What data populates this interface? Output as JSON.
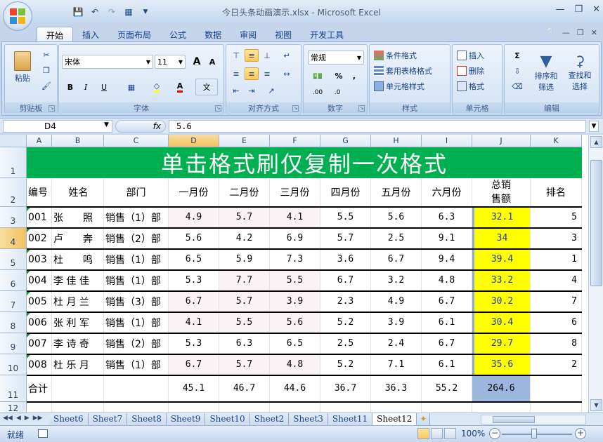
{
  "window": {
    "title": "今日头条动画演示.xlsx - Microsoft Excel",
    "minimize_icon": "minimize-icon",
    "restore_icon": "restore-icon",
    "close_icon": "close-icon"
  },
  "tabs": [
    {
      "label": "开始"
    },
    {
      "label": "插入"
    },
    {
      "label": "页面布局"
    },
    {
      "label": "公式"
    },
    {
      "label": "数据"
    },
    {
      "label": "审阅"
    },
    {
      "label": "视图"
    },
    {
      "label": "开发工具"
    }
  ],
  "ribbon": {
    "clipboard": {
      "label": "剪贴板",
      "paste": "粘贴"
    },
    "font": {
      "label": "字体",
      "name": "宋体",
      "size": "11",
      "bold": "B",
      "italic": "I",
      "underline": "U",
      "grow": "A",
      "shrink": "A",
      "font_color": "A",
      "phonetic": "文"
    },
    "alignment": {
      "label": "对齐方式"
    },
    "number": {
      "label": "数字",
      "format": "常规",
      "percent": "%",
      "comma": ",",
      "inc_decimal": ".00",
      "dec_decimal": ".0"
    },
    "styles": {
      "label": "样式",
      "conditional": "条件格式",
      "table": "套用表格格式",
      "cell_styles": "单元格样式"
    },
    "cells": {
      "label": "单元格",
      "insert": "插入",
      "delete": "删除",
      "format": "格式"
    },
    "editing": {
      "label": "编辑",
      "sum": "Σ",
      "sort": "排序和",
      "sort2": "筛选",
      "find": "查找和",
      "find2": "选择"
    }
  },
  "formula_bar": {
    "name_box": "D4",
    "fx": "fx",
    "value": "5.6"
  },
  "sheet": {
    "columns": [
      "A",
      "B",
      "C",
      "D",
      "E",
      "F",
      "G",
      "H",
      "I",
      "J",
      "K"
    ],
    "active_column": "D",
    "active_row": "4",
    "title": "单击格式刷仅复制一次格式",
    "headers": [
      "编号",
      "姓名",
      "部门",
      "一月份",
      "二月份",
      "三月份",
      "四月份",
      "五月份",
      "六月份",
      "总销售额",
      "排名"
    ],
    "header_j_line1": "总销",
    "header_j_line2": "售额",
    "rows": [
      {
        "id": "001",
        "name": "张　　照",
        "dept": "销售（1）部",
        "m": [
          "4.9",
          "5.7",
          "4.1",
          "5.5",
          "5.6",
          "6.3"
        ],
        "total": "32.1",
        "rank": "5"
      },
      {
        "id": "002",
        "name": "卢　　奔",
        "dept": "销售（2）部",
        "m": [
          "5.6",
          "4.2",
          "6.9",
          "5.7",
          "2.5",
          "9.1"
        ],
        "total": "34",
        "rank": "3"
      },
      {
        "id": "003",
        "name": "杜　　鸣",
        "dept": "销售（1）部",
        "m": [
          "6.5",
          "5.9",
          "7.3",
          "3.6",
          "6.7",
          "9.4"
        ],
        "total": "39.4",
        "rank": "1"
      },
      {
        "id": "004",
        "name": "李 佳 佳",
        "dept": "销售（1）部",
        "m": [
          "5.3",
          "7.7",
          "5.5",
          "6.7",
          "3.2",
          "4.8"
        ],
        "total": "33.2",
        "rank": "4"
      },
      {
        "id": "005",
        "name": "杜 月 兰",
        "dept": "销售（3）部",
        "m": [
          "6.7",
          "5.7",
          "3.9",
          "2.3",
          "4.9",
          "6.7"
        ],
        "total": "30.2",
        "rank": "7"
      },
      {
        "id": "006",
        "name": "张 利 军",
        "dept": "销售（1）部",
        "m": [
          "4.1",
          "5.5",
          "5.6",
          "5.2",
          "3.9",
          "6.1"
        ],
        "total": "30.4",
        "rank": "6"
      },
      {
        "id": "007",
        "name": "李 诗 奇",
        "dept": "销售（2）部",
        "m": [
          "5.3",
          "6.3",
          "6.5",
          "2.5",
          "2.4",
          "6.7"
        ],
        "total": "29.7",
        "rank": "8"
      },
      {
        "id": "008",
        "name": "杜 乐 月",
        "dept": "销售（1）部",
        "m": [
          "6.7",
          "5.7",
          "4.8",
          "5.2",
          "7.1",
          "6.1"
        ],
        "total": "35.6",
        "rank": "2"
      }
    ],
    "total_row": {
      "label": "合计",
      "m": [
        "45.1",
        "46.7",
        "44.6",
        "36.7",
        "36.3",
        "55.2"
      ],
      "total": "264.6"
    },
    "row_numbers": [
      "1",
      "2",
      "3",
      "4",
      "5",
      "6",
      "7",
      "8",
      "9",
      "10",
      "11",
      "12"
    ]
  },
  "sheet_tabs": [
    "Sheet6",
    "Sheet7",
    "Sheet8",
    "Sheet9",
    "Sheet10",
    "Sheet2",
    "Sheet3",
    "Sheet11",
    "Sheet12"
  ],
  "active_sheet": "Sheet12",
  "status": {
    "ready": "就绪",
    "zoom": "100%"
  },
  "colors": {
    "title_bg": "#00b050",
    "total_fill": "#ffff00",
    "selection": "#f1c15f"
  }
}
